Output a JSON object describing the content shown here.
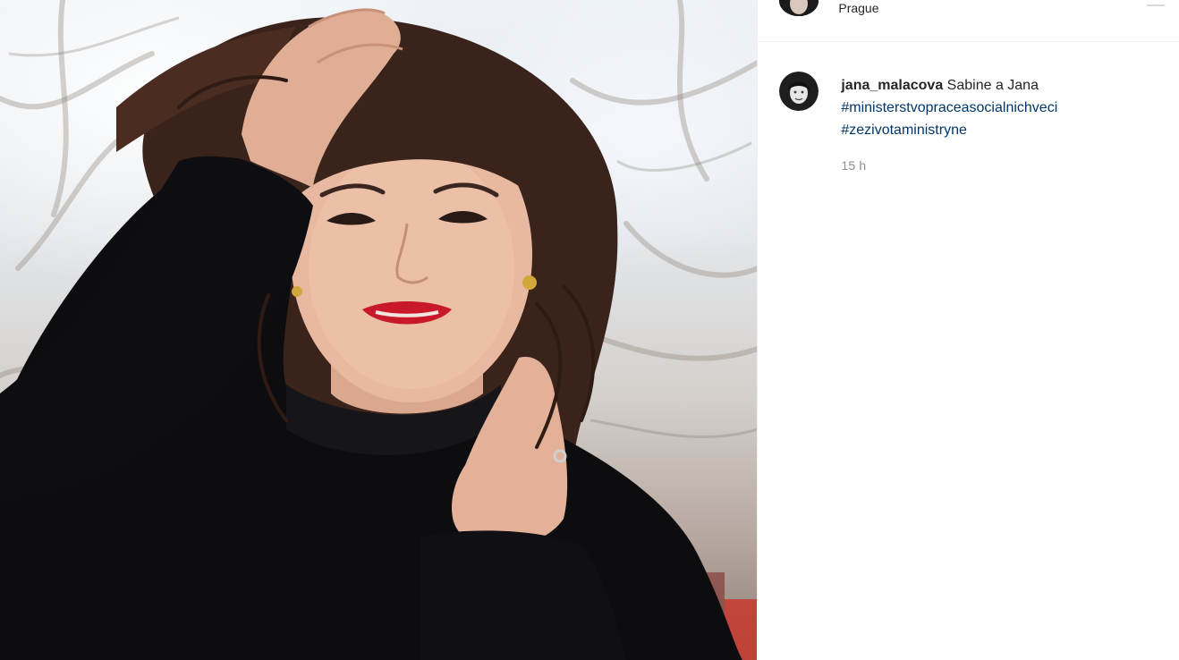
{
  "post": {
    "location": "Prague",
    "author": {
      "username": "jana_malacova"
    },
    "caption": {
      "text": "Sabine a Jana",
      "hashtags": [
        "#ministerstvopraceasocialnichveci",
        "#zezivotaministryne"
      ]
    },
    "timestamp": "15 h"
  },
  "icons": {
    "header_more": "more-options-icon"
  },
  "colors": {
    "hashtag": "#00376b",
    "timestamp": "#8e8e8e",
    "divider": "#efefef"
  }
}
